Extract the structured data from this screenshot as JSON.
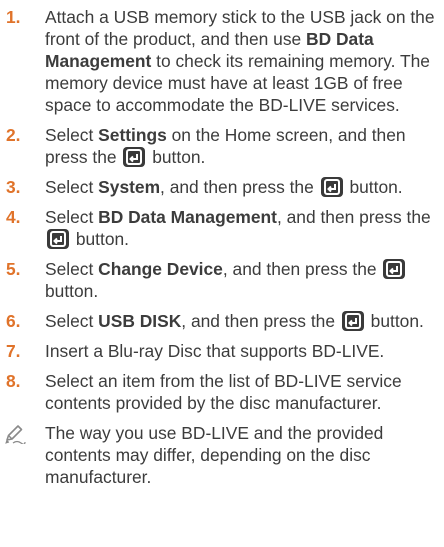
{
  "steps": [
    {
      "num": "1.",
      "pre": "Attach a USB memory stick to the USB jack on the front of the product, and then use ",
      "bold": "BD Data Management",
      "post": " to check its remaining memory. The memory device must have at least 1GB of free space to accommodate the BD-LIVE services."
    },
    {
      "num": "2.",
      "pre": "Select ",
      "bold": "Settings",
      "post": " on the Home screen, and then press the ",
      "tail": " button."
    },
    {
      "num": "3.",
      "pre": "Select ",
      "bold": "System",
      "post": ", and then press the ",
      "tail": " button."
    },
    {
      "num": "4.",
      "pre": "Select ",
      "bold": "BD Data Management",
      "post": ", and then press the ",
      "tail": " button."
    },
    {
      "num": "5.",
      "pre": "Select ",
      "bold": "Change Device",
      "post": ", and then press the ",
      "tail": " button."
    },
    {
      "num": "6.",
      "pre": "Select ",
      "bold": "USB DISK",
      "post": ", and then press the ",
      "tail": " button."
    },
    {
      "num": "7.",
      "text": "Insert a Blu-ray Disc that supports BD-LIVE."
    },
    {
      "num": "8.",
      "text": "Select an item from the list of BD-LIVE service contents provided by the disc manufacturer."
    }
  ],
  "note": {
    "icon": "pencil-icon",
    "text": "The way you use BD-LIVE and the provided contents may differ, depending on the disc manufacturer."
  },
  "colors": {
    "number": "#e0732a",
    "text": "#3c3c3c",
    "icon_bg": "#3a3a3a"
  },
  "icons": {
    "enter": "enter-button-icon"
  }
}
